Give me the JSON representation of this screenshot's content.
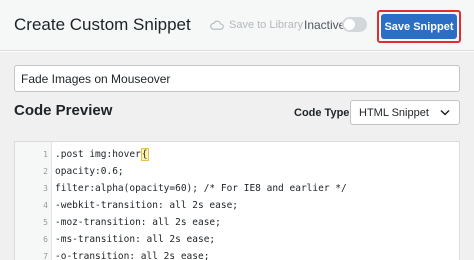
{
  "header": {
    "title": "Create Custom Snippet",
    "save_to_library": "Save to Library",
    "status_label": "Inactive",
    "active": false,
    "save_button": "Save Snippet"
  },
  "snippet": {
    "title_value": "Fade Images on Mouseover"
  },
  "code_preview": {
    "heading": "Code Preview",
    "code_type_label": "Code Type",
    "code_type_selected": "HTML Snippet",
    "lines": [
      {
        "num": "1",
        "text_before": ".post img:hover",
        "bracket": "{",
        "text_after": ""
      },
      {
        "num": "2",
        "text": "opacity:0.6;"
      },
      {
        "num": "3",
        "text": "filter:alpha(opacity=60); /* For IE8 and earlier */"
      },
      {
        "num": "4",
        "text": "-webkit-transition: all 2s ease;"
      },
      {
        "num": "5",
        "text": "-moz-transition: all 2s ease;"
      },
      {
        "num": "6",
        "text": "-ms-transition: all 2s ease;"
      },
      {
        "num": "7",
        "text": "-o-transition: all 2s ease;"
      }
    ]
  },
  "colors": {
    "accent": "#2b6ec6",
    "highlight_outline": "#e02d2d"
  },
  "icons": {
    "cloud": "cloud-icon",
    "chevron": "chevron-down-icon"
  }
}
